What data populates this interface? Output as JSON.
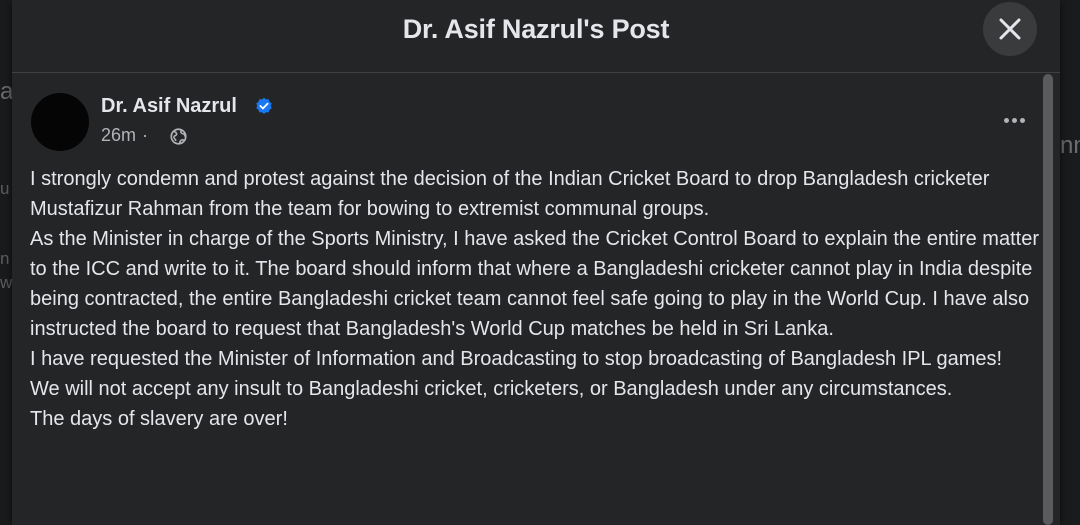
{
  "background": {
    "fragments": [
      "a",
      "u",
      "n",
      "w",
      "nn"
    ]
  },
  "modal": {
    "title": "Dr. Asif Nazrul's Post"
  },
  "post": {
    "author": "Dr. Asif Nazrul",
    "verified": true,
    "time": "26m",
    "separator": "·",
    "audience_icon": "globe-icon",
    "more_icon": "more-options-icon",
    "paragraphs": [
      "I strongly condemn and protest against the decision of the Indian Cricket Board to drop Bangladesh cricketer Mustafizur Rahman from the team for bowing to extremist communal groups.",
      "As the Minister in charge of the Sports Ministry, I have asked the Cricket Control Board to explain the entire matter to the ICC and write to it. The board should inform that where a Bangladeshi cricketer cannot play in India despite being contracted, the entire Bangladeshi cricket team cannot feel safe going to play in the World Cup. I have also instructed the board to request that Bangladesh's World Cup matches be held in Sri Lanka.",
      "I have requested the Minister of Information and Broadcasting to stop broadcasting of Bangladesh IPL games!",
      "We will not accept any insult to Bangladeshi cricket, cricketers, or Bangladesh under any circumstances.",
      "The days of slavery are over!"
    ]
  },
  "colors": {
    "modal_bg": "#242526",
    "text_primary": "#e4e6eb",
    "text_secondary": "#b0b3b8",
    "verified_badge": "#1877f2"
  }
}
